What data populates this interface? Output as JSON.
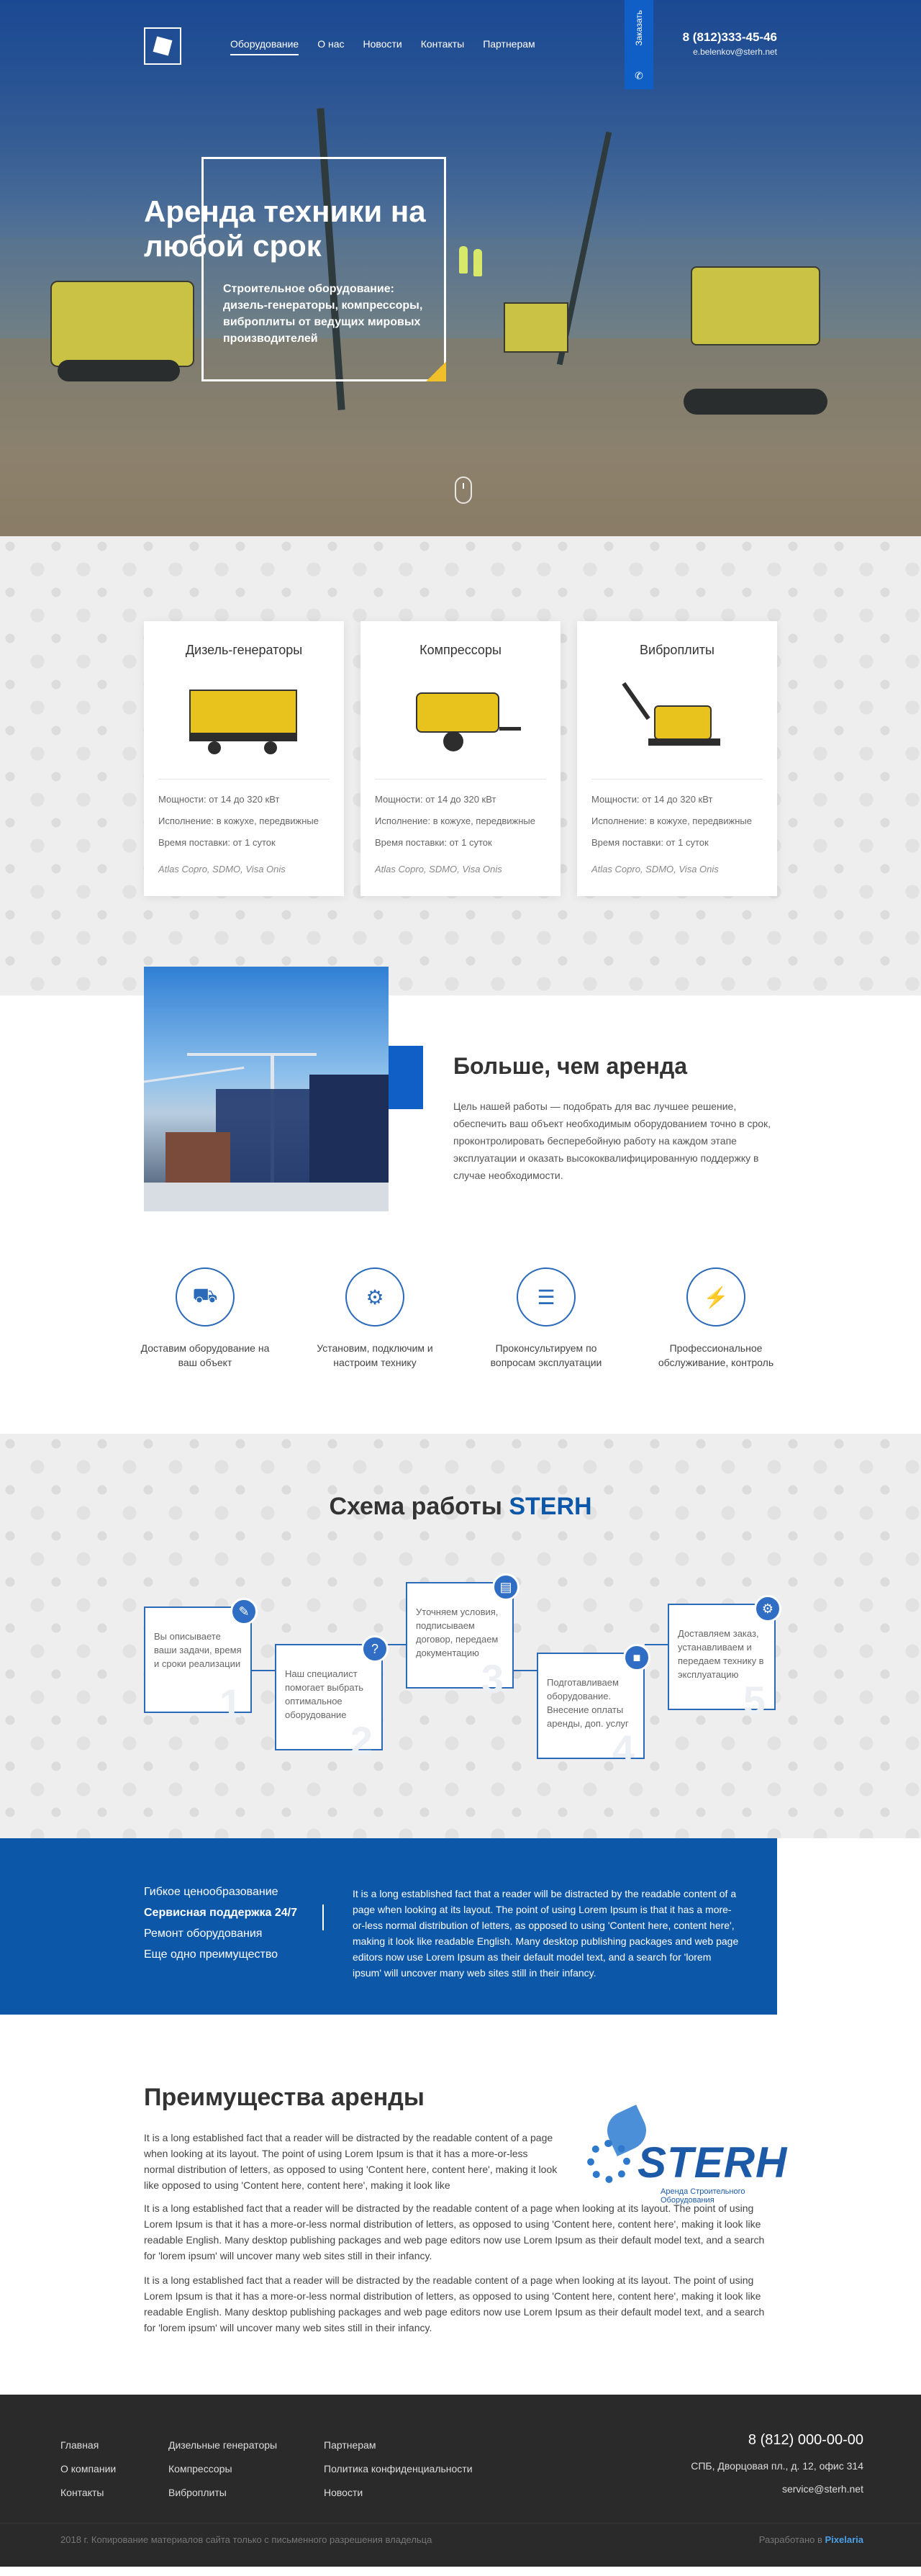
{
  "header": {
    "nav": [
      "Оборудование",
      "О нас",
      "Новости",
      "Контакты",
      "Партнерам"
    ],
    "order_label": "Заказать",
    "phone": "8 (812)333-45-46",
    "email": "e.belenkov@sterh.net"
  },
  "hero": {
    "title": "Аренда техники на любой срок",
    "subtitle": "Строительное оборудование: дизель-генераторы, компрессоры, виброплиты от ведущих мировых производителей"
  },
  "equipment": [
    {
      "title": "Дизель-генераторы",
      "power": "Мощности: от 14 до 320 кВт",
      "exec": "Исполнение: в кожухе, передвижные",
      "time": "Время поставки: от 1 суток",
      "brands": "Atlas Copro, SDMO, Visa Onis"
    },
    {
      "title": "Компрессоры",
      "power": "Мощности: от 14 до 320 кВт",
      "exec": "Исполнение: в кожухе, передвижные",
      "time": "Время поставки: от 1 суток",
      "brands": "Atlas Copro, SDMO, Visa Onis"
    },
    {
      "title": "Виброплиты",
      "power": "Мощности: от 14 до 320 кВт",
      "exec": "Исполнение: в кожухе, передвижные",
      "time": "Время поставки: от 1 суток",
      "brands": "Atlas Copro, SDMO, Visa Onis"
    }
  ],
  "more": {
    "title": "Больше, чем аренда",
    "text": "Цель нашей работы — подобрать для вас лучшее решение, обеспечить ваш объект необходимым оборудованием точно в срок, проконтролировать бесперебойную работу на каждом этапе эксплуатации и оказать высококвалифицированную поддержку в случае необходимости."
  },
  "features": [
    {
      "label": "Доставим оборудование на ваш объект",
      "icon": "truck-icon"
    },
    {
      "label": "Установим, подключим и настроим технику",
      "icon": "settings-icon"
    },
    {
      "label": "Проконсультируем по вопросам эксплуатации",
      "icon": "consult-icon"
    },
    {
      "label": "Профессиональное обслуживание, контроль",
      "icon": "service-icon"
    }
  ],
  "schema": {
    "title_prefix": "Схема работы",
    "title_brand": "STERH",
    "steps": [
      {
        "text": "Вы описываете ваши задачи, время и сроки реализации",
        "num": "1",
        "icon": "pencil-icon"
      },
      {
        "text": "Наш специалист помогает выбрать оптимальное оборудование",
        "num": "2",
        "icon": "question-icon"
      },
      {
        "text": "Уточняем условия, подписываем договор, передаем документацию",
        "num": "3",
        "icon": "document-icon"
      },
      {
        "text": "Подготавливаем оборудование. Внесение оплаты аренды, доп. услуг",
        "num": "4",
        "icon": "box-icon"
      },
      {
        "text": "Доставляем заказ, устанавливаем и передаем технику в эксплуатацию",
        "num": "5",
        "icon": "gear-icon"
      }
    ]
  },
  "advantages": {
    "items": [
      "Гибкое ценообразование",
      "Сервисная поддержка 24/7",
      "Ремонт оборудования",
      "Еще одно преимущество"
    ],
    "active_index": 1,
    "text": "It is a long established fact that a reader will be distracted by the readable content of a page when looking at its layout. The point of using Lorem Ipsum is that it has a more-or-less normal distribution of letters, as opposed to using 'Content here, content here', making it look like readable English. Many desktop publishing packages and web page editors now use Lorem Ipsum as their default model text, and a search for 'lorem ipsum' will uncover many web sites still in their infancy."
  },
  "benefits": {
    "title": "Преимущества аренды",
    "p1": "It is a long established fact that a reader will be distracted by the readable content of a page when looking at its layout. The point of using Lorem Ipsum is that it has a more-or-less normal distribution of letters, as opposed to using 'Content here, content here', making it look like opposed to using 'Content here, content here', making it look like",
    "p2": "It is a long established fact that a reader will be distracted by the readable content of a page when looking at its layout. The point of using Lorem Ipsum is that it has a more-or-less normal distribution of letters, as opposed to using 'Content here, content here', making it look like readable English. Many desktop publishing packages and web page editors now use Lorem Ipsum as their default model text, and a search for 'lorem ipsum' will uncover many web sites still in their infancy.",
    "p3": "It is a long established fact that a reader will be distracted by the readable content of a page when looking at its layout. The point of using Lorem Ipsum is that it has a more-or-less normal distribution of letters, as opposed to using 'Content here, content here', making it look like readable English. Many desktop publishing packages and web page editors now use Lorem Ipsum as their default model text, and a search for 'lorem ipsum' will uncover many web sites still in their infancy.",
    "logo_word": "STERH",
    "logo_tag": "Аренда Строительного Оборудования"
  },
  "footer": {
    "col1": [
      "Главная",
      "О компании",
      "Контакты"
    ],
    "col2": [
      "Дизельные генераторы",
      "Компрессоры",
      "Виброплиты"
    ],
    "col3": [
      "Партнерам",
      "Политика конфиденциальности",
      "Новости"
    ],
    "phone": "8 (812) 000-00-00",
    "address": "СПБ, Дворцовая пл., д. 12, офис 314",
    "email": "service@sterh.net",
    "copyright": "2018 г. Копирование материалов сайта только с письменного разрешения владельца",
    "dev_prefix": "Разработано в",
    "dev_name": "Pixelaria"
  },
  "colors": {
    "accent": "#0d57a8",
    "accent_light": "#2f6ec4",
    "footer_bg": "#2a2a2a",
    "highlight": "#f0c02a"
  }
}
